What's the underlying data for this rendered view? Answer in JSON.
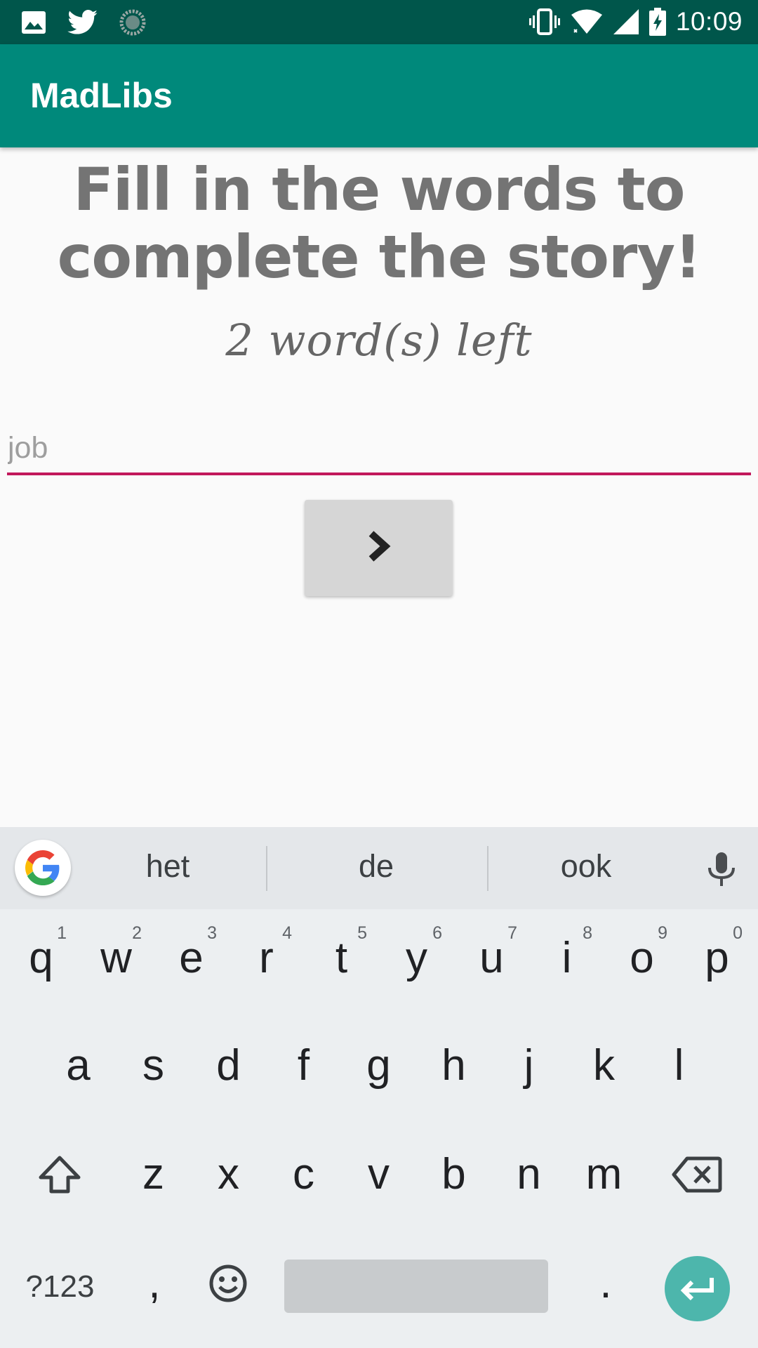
{
  "status_bar": {
    "time": "10:09",
    "left_icons": [
      "image-icon",
      "twitter-icon",
      "sync-icon"
    ],
    "right_icons": [
      "vibrate-icon",
      "wifi-icon",
      "signal-icon",
      "battery-charging-icon"
    ]
  },
  "app_bar": {
    "title": "MadLibs"
  },
  "content": {
    "headline_line1": "Fill in the words to",
    "headline_line2": "complete the story!",
    "words_left": "2 word(s) left",
    "input_placeholder": "job",
    "input_value": "",
    "next_icon": "chevron-right-icon"
  },
  "keyboard": {
    "suggestions": [
      "het",
      "de",
      "ook"
    ],
    "row1": [
      {
        "key": "q",
        "hint": "1"
      },
      {
        "key": "w",
        "hint": "2"
      },
      {
        "key": "e",
        "hint": "3"
      },
      {
        "key": "r",
        "hint": "4"
      },
      {
        "key": "t",
        "hint": "5"
      },
      {
        "key": "y",
        "hint": "6"
      },
      {
        "key": "u",
        "hint": "7"
      },
      {
        "key": "i",
        "hint": "8"
      },
      {
        "key": "o",
        "hint": "9"
      },
      {
        "key": "p",
        "hint": "0"
      }
    ],
    "row2": [
      "a",
      "s",
      "d",
      "f",
      "g",
      "h",
      "j",
      "k",
      "l"
    ],
    "row3": [
      "z",
      "x",
      "c",
      "v",
      "b",
      "n",
      "m"
    ],
    "symbols_label": "?123",
    "comma": ",",
    "period": "."
  },
  "colors": {
    "status_bar": "#00564b",
    "app_bar": "#00897b",
    "input_underline": "#c2185b",
    "enter_key": "#4db6ac"
  }
}
